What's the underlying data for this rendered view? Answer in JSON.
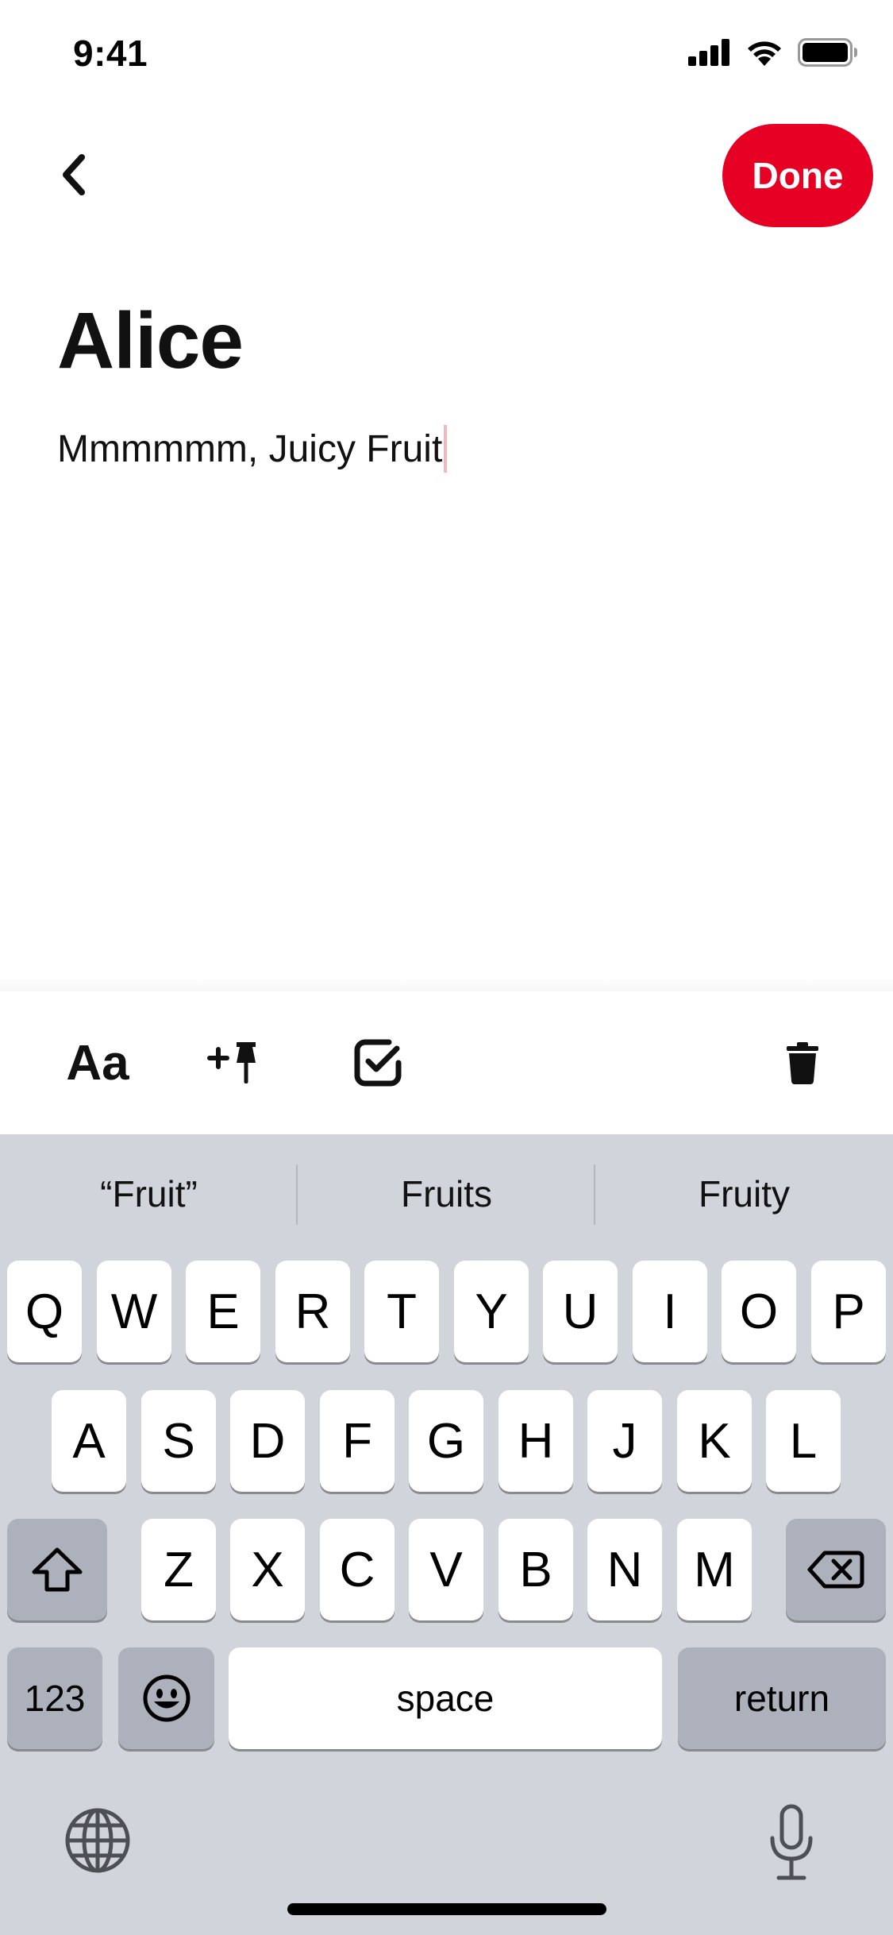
{
  "status_bar": {
    "time": "9:41"
  },
  "header": {
    "done_label": "Done"
  },
  "note": {
    "title": "Alice",
    "body": "Mmmmmm, Juicy Fruit"
  },
  "toolbar": {
    "text_style_label": "Aa"
  },
  "keyboard": {
    "suggestions": [
      "“Fruit”",
      "Fruits",
      "Fruity"
    ],
    "row1": [
      "Q",
      "W",
      "E",
      "R",
      "T",
      "Y",
      "U",
      "I",
      "O",
      "P"
    ],
    "row2": [
      "A",
      "S",
      "D",
      "F",
      "G",
      "H",
      "J",
      "K",
      "L"
    ],
    "row3": [
      "Z",
      "X",
      "C",
      "V",
      "B",
      "N",
      "M"
    ],
    "numbers_label": "123",
    "space_label": "space",
    "return_label": "return"
  },
  "colors": {
    "accent": "#e60023",
    "keyboard_bg": "#d1d4db",
    "dark_key": "#adb1bb"
  },
  "icons": [
    "cellular-signal-icon",
    "wifi-icon",
    "battery-icon",
    "back-chevron-icon",
    "add-pin-icon",
    "checkbox-icon",
    "trash-icon",
    "shift-icon",
    "backspace-icon",
    "emoji-icon",
    "globe-icon",
    "microphone-icon"
  ]
}
